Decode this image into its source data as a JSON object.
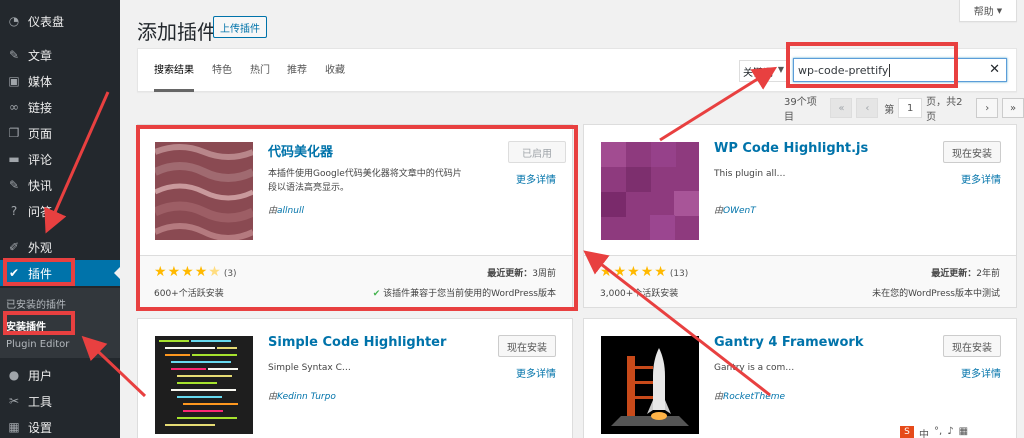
{
  "sidebar": {
    "items": [
      {
        "label": "仪表盘"
      },
      {
        "label": "文章"
      },
      {
        "label": "媒体"
      },
      {
        "label": "链接"
      },
      {
        "label": "页面"
      },
      {
        "label": "评论"
      },
      {
        "label": "快讯"
      },
      {
        "label": "问答"
      },
      {
        "label": "外观"
      },
      {
        "label": "插件"
      },
      {
        "label": "用户"
      },
      {
        "label": "工具"
      },
      {
        "label": "设置"
      }
    ],
    "submenu": [
      "已安装的插件",
      "安装插件",
      "Plugin Editor"
    ]
  },
  "header": {
    "title": "添加插件",
    "upload_label": "上传插件",
    "help_label": "帮助"
  },
  "filter": {
    "tabs": [
      "搜索结果",
      "特色",
      "热门",
      "推荐",
      "收藏"
    ],
    "search_type": "关键词",
    "search_value": "wp-code-prettify"
  },
  "pagination": {
    "count": "39个项目",
    "first": "«",
    "prev": "‹",
    "page_prefix": "第",
    "current_page": "1",
    "page_suffix": "页，共2页",
    "next": "›",
    "last": "»"
  },
  "plugins": [
    {
      "name": "代码美化器",
      "description": "本插件使用Google代码美化器将文章中的代码片段以语法高亮显示。",
      "author_prefix": "由",
      "author": "allnull",
      "action": "已启用",
      "more": "更多详情",
      "rating": 4.5,
      "rating_count": "(3)",
      "installs": "600+个活跃安装",
      "updated_label": "最近更新：",
      "updated": "3周前",
      "compat": "该插件兼容于您当前使用的WordPress版本"
    },
    {
      "name": "WP Code Highlight.js",
      "description": "This plugin all…",
      "author_prefix": "由",
      "author": "OWenT",
      "action": "现在安装",
      "more": "更多详情",
      "rating": 5,
      "rating_count": "(13)",
      "installs": "3,000+个活跃安装",
      "updated_label": "最近更新：",
      "updated": "2年前",
      "compat": "未在您的WordPress版本中测试"
    },
    {
      "name": "Simple Code Highlighter",
      "description": "Simple Syntax C…",
      "author_prefix": "由",
      "author": "Kedinn Turpo",
      "action": "现在安装",
      "more": "更多详情"
    },
    {
      "name": "Gantry 4 Framework",
      "description": "Gantry is a com…",
      "author_prefix": "由",
      "author": "RocketTheme",
      "action": "现在安装",
      "more": "更多详情"
    }
  ],
  "tray": {
    "s_logo": "S",
    "lang": "中"
  },
  "colors": {
    "sidebar_bg": "#23282d",
    "active_menu": "#0073aa",
    "link": "#0073aa",
    "star": "#ffb900",
    "annotation": "#e84040"
  }
}
